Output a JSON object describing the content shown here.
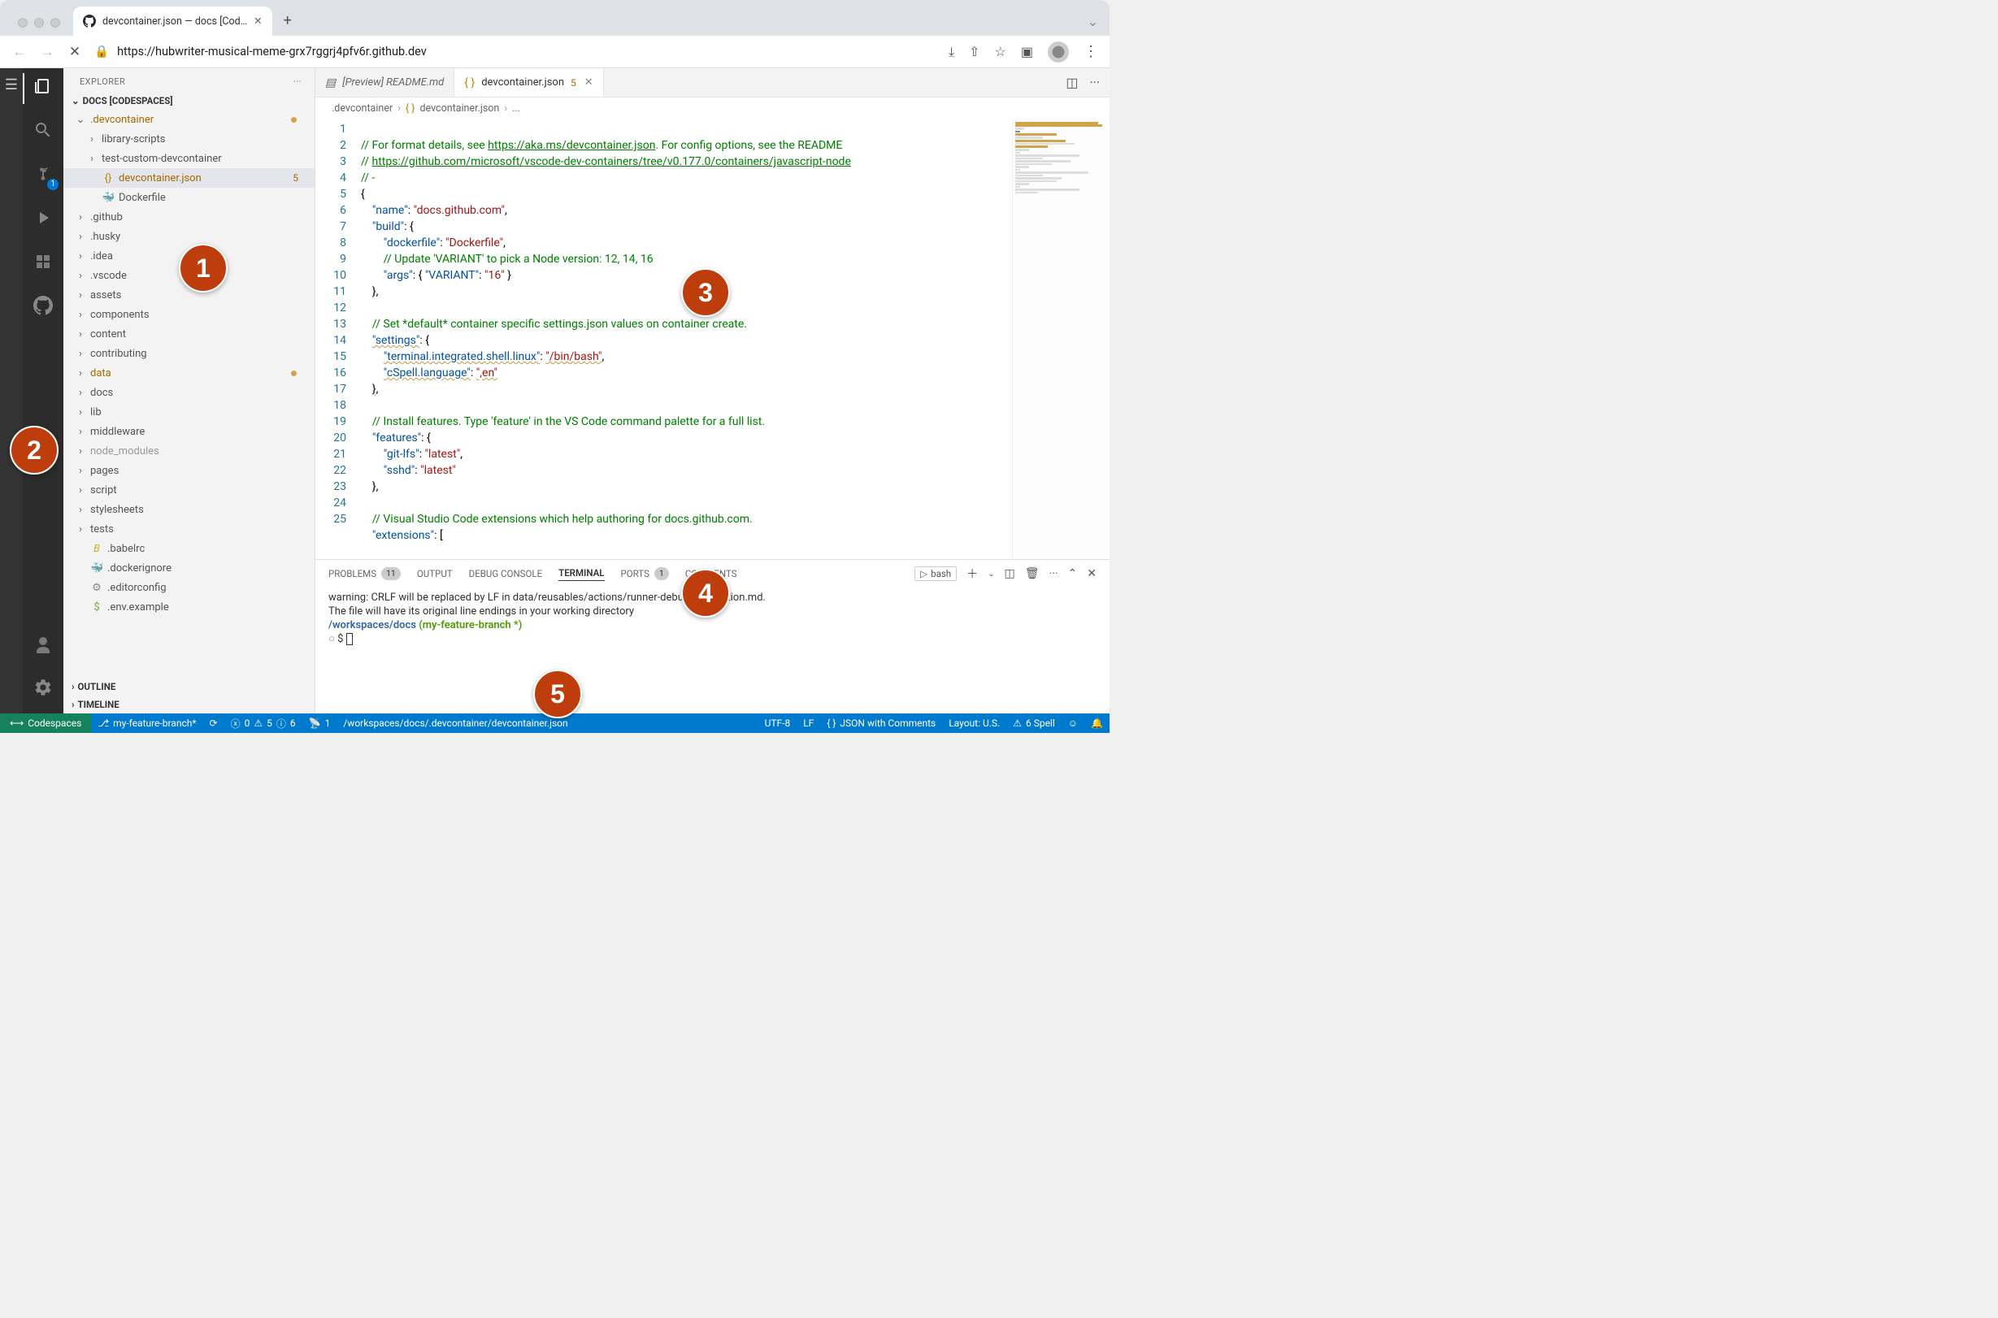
{
  "browser": {
    "tab_title": "devcontainer.json — docs [Cod…",
    "url_display": "https://hubwriter-musical-meme-grx7rggrj4pfv6r.github.dev"
  },
  "sidebar": {
    "title": "EXPLORER",
    "section": "DOCS [CODESPACES]",
    "outline": "OUTLINE",
    "timeline": "TIMELINE",
    "tree": [
      {
        "label": ".devcontainer",
        "type": "folder",
        "open": true,
        "modified": true,
        "indent": 1,
        "dot": true
      },
      {
        "label": "library-scripts",
        "type": "folder",
        "open": false,
        "indent": 2
      },
      {
        "label": "test-custom-devcontainer",
        "type": "folder",
        "open": false,
        "indent": 2
      },
      {
        "label": "devcontainer.json",
        "type": "file",
        "icon": "{}",
        "iconcolor": "#b58900",
        "indent": 2,
        "selected": true,
        "modified": true,
        "badge": "5"
      },
      {
        "label": "Dockerfile",
        "type": "file",
        "icon": "🐳",
        "indent": 2
      },
      {
        "label": ".github",
        "type": "folder",
        "indent": 1
      },
      {
        "label": ".husky",
        "type": "folder",
        "indent": 1
      },
      {
        "label": ".idea",
        "type": "folder",
        "indent": 1
      },
      {
        "label": ".vscode",
        "type": "folder",
        "indent": 1
      },
      {
        "label": "assets",
        "type": "folder",
        "indent": 1
      },
      {
        "label": "components",
        "type": "folder",
        "indent": 1
      },
      {
        "label": "content",
        "type": "folder",
        "indent": 1
      },
      {
        "label": "contributing",
        "type": "folder",
        "indent": 1
      },
      {
        "label": "data",
        "type": "folder",
        "indent": 1,
        "modified": true,
        "dot": true
      },
      {
        "label": "docs",
        "type": "folder",
        "indent": 1
      },
      {
        "label": "lib",
        "type": "folder",
        "indent": 1
      },
      {
        "label": "middleware",
        "type": "folder",
        "indent": 1
      },
      {
        "label": "node_modules",
        "type": "folder",
        "indent": 1,
        "faded": true
      },
      {
        "label": "pages",
        "type": "folder",
        "indent": 1
      },
      {
        "label": "script",
        "type": "folder",
        "indent": 1
      },
      {
        "label": "stylesheets",
        "type": "folder",
        "indent": 1
      },
      {
        "label": "tests",
        "type": "folder",
        "indent": 1
      },
      {
        "label": ".babelrc",
        "type": "file",
        "icon": "B",
        "iconcolor": "#cab023",
        "indent": 1,
        "italic": true
      },
      {
        "label": ".dockerignore",
        "type": "file",
        "icon": "🐳",
        "iconcolor": "#888",
        "indent": 1
      },
      {
        "label": ".editorconfig",
        "type": "file",
        "icon": "⚙",
        "iconcolor": "#888",
        "indent": 1
      },
      {
        "label": ".env.example",
        "type": "file",
        "icon": "$",
        "iconcolor": "#6cab3c",
        "indent": 1
      }
    ]
  },
  "activity_badge": "1",
  "editor": {
    "tabs": [
      {
        "label": "[Preview] README.md",
        "icon": "▤",
        "italic": true,
        "active": false
      },
      {
        "label": "devcontainer.json",
        "icon": "{}",
        "active": true,
        "badge": "5",
        "close": true
      }
    ],
    "breadcrumb": [
      ".devcontainer",
      "devcontainer.json",
      "..."
    ],
    "line_count": 25
  },
  "code": {
    "l1a": "// For format details, see ",
    "l1b": "https://aka.ms/devcontainer.json",
    "l1c": ". For config options, see the README",
    "l2a": "// ",
    "l2b": "https://github.com/microsoft/vscode-dev-containers/tree/v0.177.0/containers/javascript-node",
    "l3": "// -",
    "l4": "{",
    "l5k": "\"name\"",
    "l5v": "\"docs.github.com\"",
    "l5p": ": ",
    "l5e": ",",
    "l6k": "\"build\"",
    "l6p": ": {",
    "l7k": "\"dockerfile\"",
    "l7v": "\"Dockerfile\"",
    "l7p": ": ",
    "l7e": ",",
    "l8": "// Update 'VARIANT' to pick a Node version: 12, 14, 16",
    "l9k": "\"args\"",
    "l9p": ": { ",
    "l9k2": "\"VARIANT\"",
    "l9p2": ": ",
    "l9v": "\"16\"",
    "l9e": " }",
    "l10": "},",
    "l12": "// Set *default* container specific settings.json values on container create.",
    "l13k": "\"settings\"",
    "l13p": ": {",
    "l14k": "\"terminal.integrated.shell.linux\"",
    "l14p": ": ",
    "l14v": "\"/bin/bash\"",
    "l14e": ",",
    "l15k": "\"cSpell.language\"",
    "l15p": ": ",
    "l15v": "\",en\"",
    "l16": "},",
    "l18": "// Install features. Type 'feature' in the VS Code command palette for a full list.",
    "l19k": "\"features\"",
    "l19p": ": {",
    "l20k": "\"git-lfs\"",
    "l20p": ": ",
    "l20v": "\"latest\"",
    "l20e": ",",
    "l21k": "\"sshd\"",
    "l21p": ": ",
    "l21v": "\"latest\"",
    "l22": "},",
    "l24": "// Visual Studio Code extensions which help authoring for docs.github.com.",
    "l25k": "\"extensions\"",
    "l25p": ": ["
  },
  "panel": {
    "tabs": {
      "problems": "PROBLEMS",
      "problems_badge": "11",
      "output": "OUTPUT",
      "debug": "DEBUG CONSOLE",
      "terminal": "TERMINAL",
      "ports": "PORTS",
      "ports_badge": "1",
      "comments": "COMMENTS"
    },
    "term_selector": "bash",
    "term_line1": "warning: CRLF will be replaced by LF in data/reusables/actions/runner-debug-description.md.",
    "term_line2": "The file will have its original line endings in your working directory",
    "term_path": "/workspaces/docs",
    "term_branch": "(my-feature-branch *)",
    "term_prompt": "$ "
  },
  "status": {
    "remote": "Codespaces",
    "branch": "my-feature-branch*",
    "sync": "",
    "errors": "0",
    "warnings": "5",
    "info": "6",
    "ports": "1",
    "path": "/workspaces/docs/.devcontainer/devcontainer.json",
    "encoding": "UTF-8",
    "eol": "LF",
    "lang": "JSON with Comments",
    "layout": "Layout: U.S.",
    "spell": "6 Spell"
  },
  "annotations": [
    "1",
    "2",
    "3",
    "4",
    "5"
  ]
}
